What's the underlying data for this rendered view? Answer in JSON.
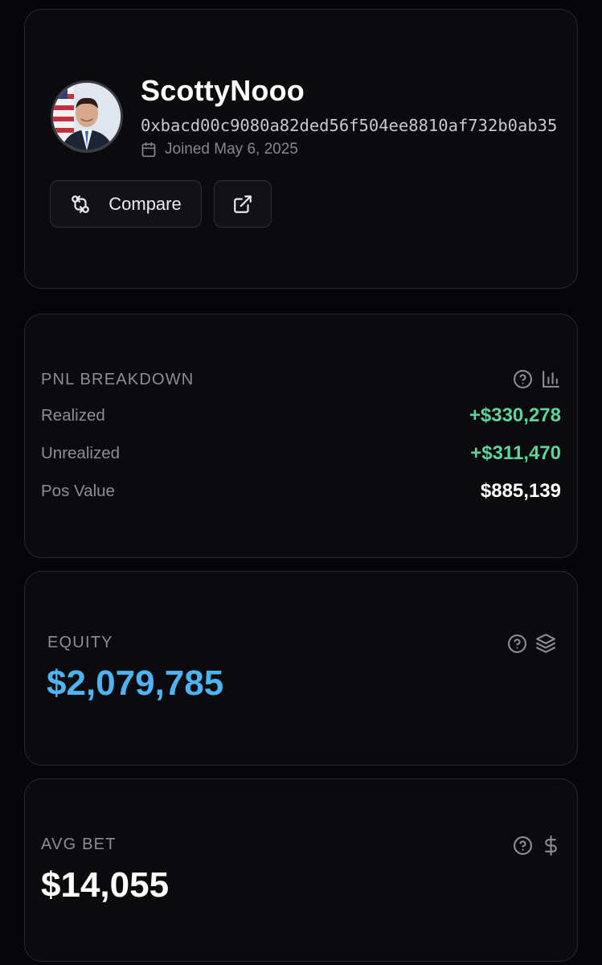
{
  "profile": {
    "username": "ScottyNooo",
    "address": "0xbacd00c9080a82ded56f504ee8810af732b0ab35",
    "joined": "Joined May 6, 2025",
    "compare_label": "Compare"
  },
  "pnl": {
    "title": "PNL BREAKDOWN",
    "rows": [
      {
        "label": "Realized",
        "value": "+$330,278"
      },
      {
        "label": "Unrealized",
        "value": "+$311,470"
      },
      {
        "label": "Pos Value",
        "value": "$885,139"
      }
    ]
  },
  "equity": {
    "title": "EQUITY",
    "value": "$2,079,785"
  },
  "avg_bet": {
    "title": "AVG BET",
    "value": "$14,055"
  },
  "colors": {
    "positive": "#5ed49a",
    "equity_accent": "#4fb3f2",
    "muted": "#8d8d94",
    "card_border": "#2a2a2f"
  },
  "icons": [
    "avatar-photo",
    "calendar-icon",
    "compare-icon",
    "external-link-icon",
    "help-icon",
    "bar-chart-icon",
    "layers-icon",
    "dollar-icon"
  ]
}
